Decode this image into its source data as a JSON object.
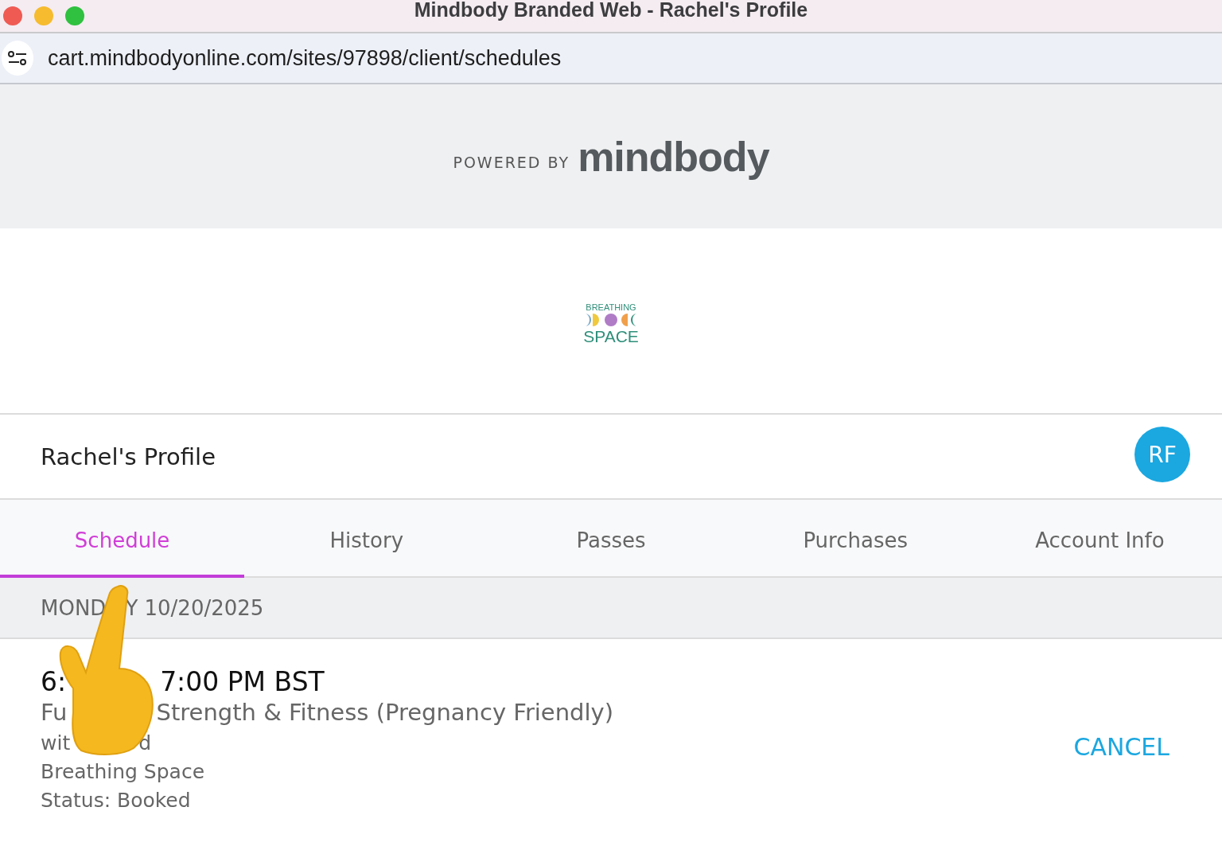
{
  "window": {
    "title": "Mindbody Branded Web - Rachel's Profile"
  },
  "address_bar": {
    "url": "cart.mindbodyonline.com/sites/97898/client/schedules"
  },
  "banner": {
    "prefix": "POWERED BY",
    "brand": "mindbody"
  },
  "studio_logo": {
    "top": "BREATHING",
    "bottom": "SPACE"
  },
  "profile": {
    "title": "Rachel's Profile",
    "initials": "RF"
  },
  "tabs": [
    {
      "label": "Schedule",
      "selected": true
    },
    {
      "label": "History",
      "selected": false
    },
    {
      "label": "Passes",
      "selected": false
    },
    {
      "label": "Purchases",
      "selected": false
    },
    {
      "label": "Account Info",
      "selected": false
    }
  ],
  "date_header": {
    "parts": [
      "MOND",
      "Y 10/20/2025"
    ]
  },
  "booking": {
    "time": [
      "6:",
      "7:00 PM BST"
    ],
    "class_name": [
      "Fu",
      "Strength & Fitness (Pregnancy Friendly)"
    ],
    "instructor": [
      "wit",
      "d"
    ],
    "location": "Breathing Space",
    "status": "Status: Booked",
    "action": "CANCEL"
  }
}
